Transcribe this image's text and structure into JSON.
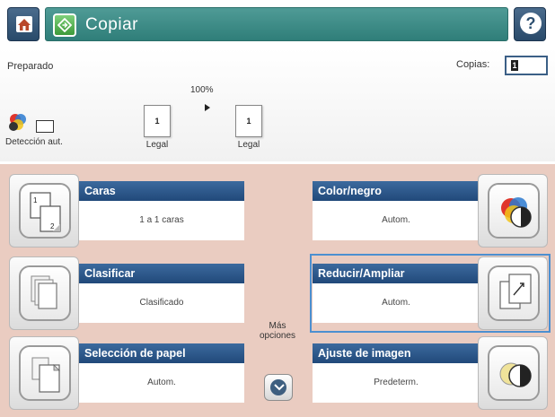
{
  "header": {
    "title": "Copiar",
    "home_icon": "home-icon",
    "help_icon": "help-icon",
    "help_glyph": "?"
  },
  "status": {
    "state": "Preparado",
    "copies_label": "Copias:",
    "copies_value": "1",
    "zoom": "100%",
    "original": {
      "page_number": "1",
      "size": "Legal"
    },
    "output": {
      "page_number": "1",
      "size": "Legal"
    },
    "detect_label": "Detección aut."
  },
  "options": {
    "caras": {
      "title": "Caras",
      "value": "1 a 1 caras"
    },
    "color": {
      "title": "Color/negro",
      "value": "Autom."
    },
    "clasificar": {
      "title": "Clasificar",
      "value": "Clasificado"
    },
    "reducir": {
      "title": "Reducir/Ampliar",
      "value": "Autom."
    },
    "papel": {
      "title": "Selección de papel",
      "value": "Autom."
    },
    "ajuste": {
      "title": "Ajuste de imagen",
      "value": "Predeterm."
    },
    "more_line1": "Más",
    "more_line2": "opciones"
  },
  "colors": {
    "title_bar": "#3a8a85",
    "option_header": "#2b5589",
    "options_background": "#eaccc1",
    "nav_button": "#2f5070"
  }
}
